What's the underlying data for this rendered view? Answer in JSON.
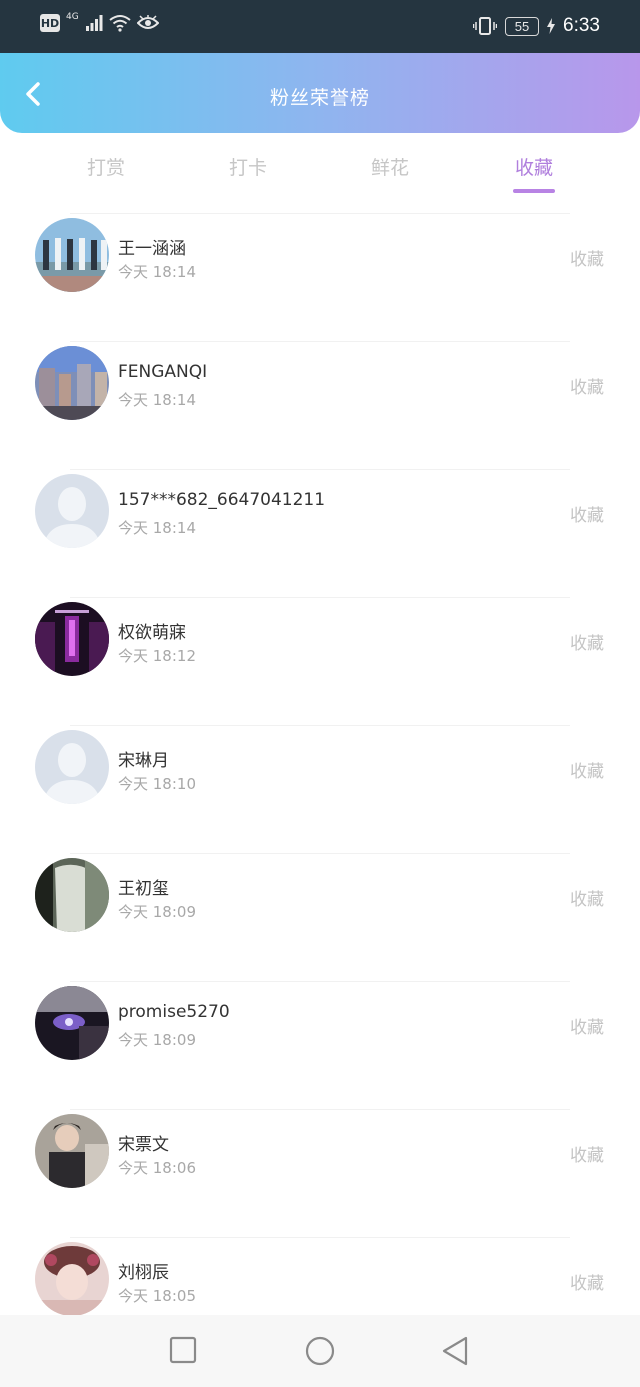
{
  "status_bar": {
    "hd": "HD",
    "network": "4G",
    "battery": "55",
    "time": "6:33"
  },
  "header": {
    "title": "粉丝荣誉榜"
  },
  "tabs": [
    {
      "label": "打赏"
    },
    {
      "label": "打卡"
    },
    {
      "label": "鲜花"
    },
    {
      "label": "收藏"
    }
  ],
  "active_tab": "收藏",
  "list": [
    {
      "name": "王一涵涵",
      "time": "今天 18:14",
      "action": "收藏"
    },
    {
      "name": "FENGANQI",
      "time": "今天 18:14",
      "action": "收藏"
    },
    {
      "name": "157***682_6647041211",
      "time": "今天 18:14",
      "action": "收藏"
    },
    {
      "name": "权欲萌寐",
      "time": "今天 18:12",
      "action": "收藏"
    },
    {
      "name": "宋琳月",
      "time": "今天 18:10",
      "action": "收藏"
    },
    {
      "name": "王初玺",
      "time": "今天 18:09",
      "action": "收藏"
    },
    {
      "name": "promise5270",
      "time": "今天 18:09",
      "action": "收藏"
    },
    {
      "name": "宋票文",
      "time": "今天 18:06",
      "action": "收藏"
    },
    {
      "name": "刘栩辰",
      "time": "今天 18:05",
      "action": "收藏"
    }
  ],
  "colors": {
    "header_gradient_start": "#5fcbef",
    "header_gradient_end": "#b897eb",
    "active_tab": "#b07fdd",
    "inactive_tab": "#c6c6c6"
  }
}
